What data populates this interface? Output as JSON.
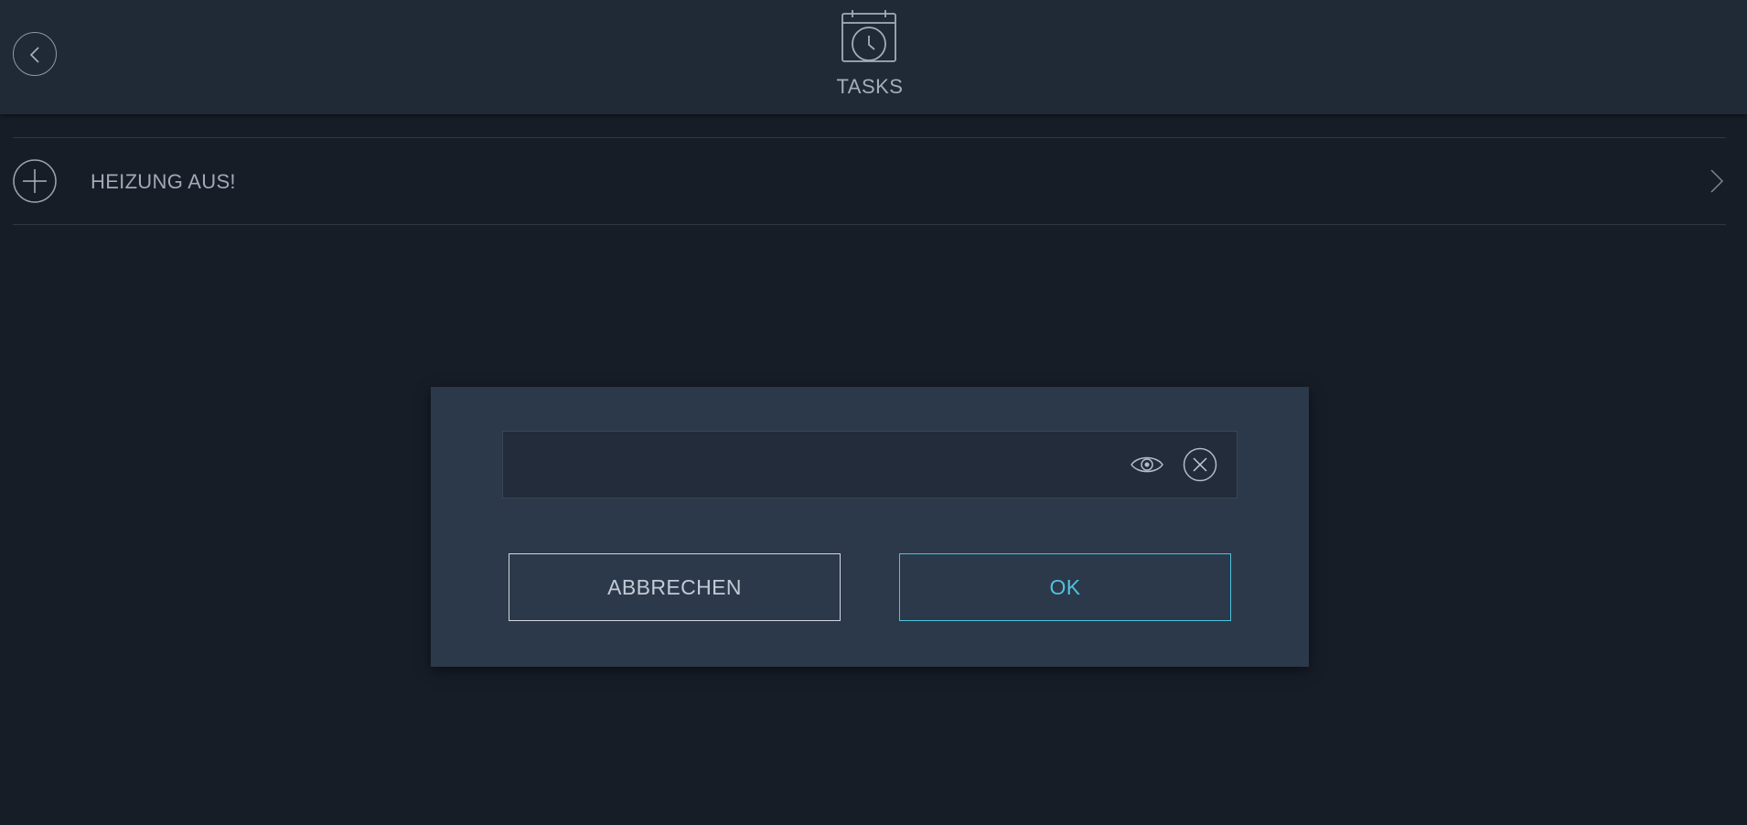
{
  "header": {
    "title": "TASKS",
    "back_icon": "chevron-left-icon",
    "title_icon": "calendar-clock-icon"
  },
  "list": {
    "items": [
      {
        "label": "HEIZUNG AUS!",
        "leading_icon": "plus-circle-icon",
        "trailing_icon": "chevron-right-icon"
      }
    ]
  },
  "dialog": {
    "input": {
      "value": "",
      "placeholder": ""
    },
    "visibility_icon": "eye-icon",
    "clear_icon": "close-circle-icon",
    "cancel_label": "ABBRECHEN",
    "ok_label": "OK"
  },
  "colors": {
    "background": "#171d27",
    "header": "#202a37",
    "dialog": "#2c394b",
    "accent": "#4ec3dc",
    "text": "#a4adba"
  }
}
